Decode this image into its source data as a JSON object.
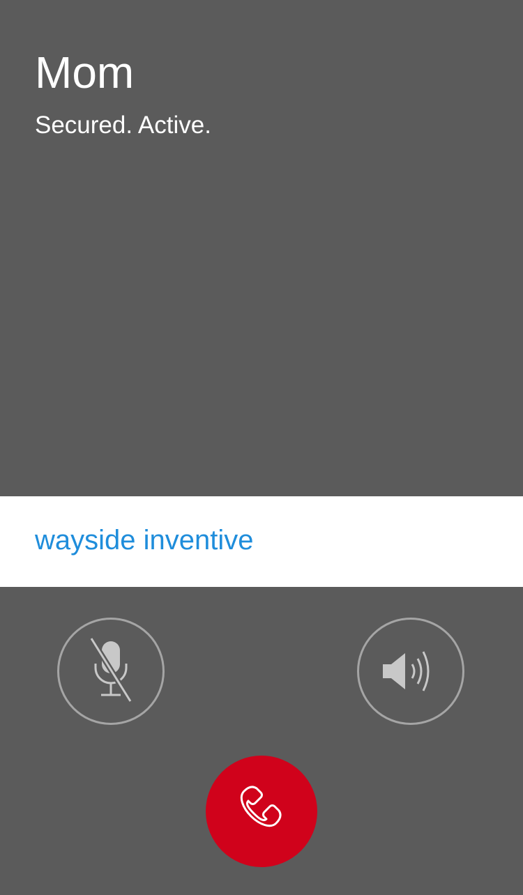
{
  "call": {
    "caller_name": "Mom",
    "status": "Secured. Active."
  },
  "verification": {
    "phrase": "wayside inventive"
  },
  "controls": {
    "mute_icon": "microphone-muted-icon",
    "speaker_icon": "speaker-icon",
    "end_call_icon": "phone-hangup-icon"
  },
  "colors": {
    "background": "#5b5b5b",
    "phrase_bar": "#ffffff",
    "phrase_text": "#1f8ddb",
    "end_call": "#d0021b",
    "icon_gray": "#a5a5a5"
  }
}
